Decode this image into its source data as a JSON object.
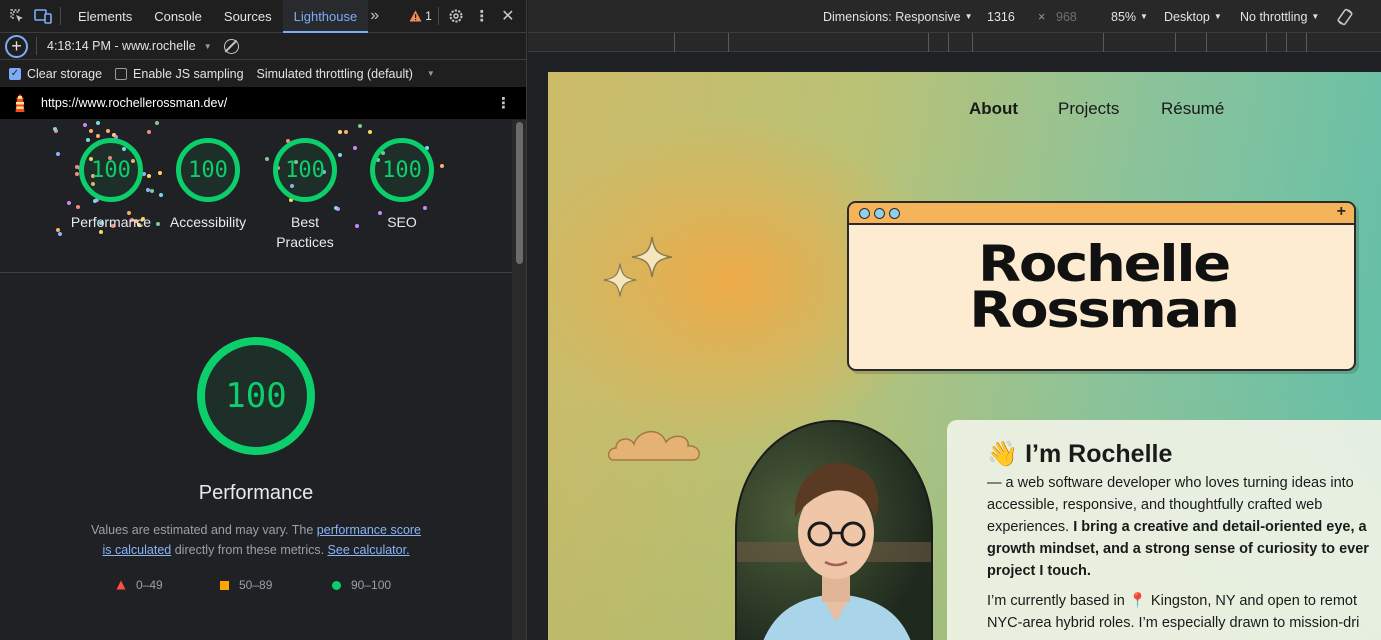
{
  "devtools": {
    "tabs": [
      "Elements",
      "Console",
      "Sources",
      "Lighthouse"
    ],
    "active_tab": "Lighthouse",
    "more_tabs_icon": "chevron-double-right-icon",
    "warning_count": "1",
    "toolbar_icons": [
      "inspect-element-icon",
      "device-toolbar-icon",
      "settings-icon",
      "more-vertical-icon",
      "close-icon"
    ],
    "report_selector": "4:18:14 PM - www.rochelle",
    "options": {
      "clear_storage": "Clear storage",
      "clear_storage_checked": true,
      "js_sampling": "Enable JS sampling",
      "js_sampling_checked": false,
      "throttling": "Simulated throttling (default)"
    },
    "url": "https://www.rochellerossman.dev/",
    "scores": [
      {
        "label": "Performance",
        "score": "100"
      },
      {
        "label": "Accessibility",
        "score": "100"
      },
      {
        "label": "Best Practices",
        "score": "100"
      },
      {
        "label": "SEO",
        "score": "100"
      }
    ],
    "performance": {
      "score": "100",
      "title": "Performance",
      "desc_1": "Values are estimated and may vary. The ",
      "desc_link_1": "performance score is calculated",
      "desc_2": " directly from these metrics. ",
      "desc_link_2": "See calculator."
    },
    "legend": [
      {
        "range": "0–49",
        "color": "#ff4e42",
        "shape": "triangle"
      },
      {
        "range": "50–89",
        "color": "#ffa400",
        "shape": "square"
      },
      {
        "range": "90–100",
        "color": "#0cce6b",
        "shape": "circle"
      }
    ]
  },
  "device_toolbar": {
    "dimensions_label": "Dimensions: Responsive",
    "width": "1316",
    "times": "×",
    "height": "968",
    "zoom": "85%",
    "device_type": "Desktop",
    "throttling": "No throttling",
    "rotate_icon": "rotate-icon"
  },
  "site": {
    "nav": [
      "About",
      "Projects",
      "Résumé"
    ],
    "name_line1": "Rochelle",
    "name_line2": "Rossman",
    "window_plus": "+",
    "about_emoji": "👋",
    "about_title": "I’m Rochelle",
    "about_line1": "— a web software developer who loves turning ideas into",
    "about_line2": "accessible, responsive, and thoughtfully crafted web",
    "about_line3_plain": "experiences. ",
    "about_line3_bold": "I bring a creative and detail-oriented eye, a",
    "about_line4_bold": "growth mindset, and a strong sense of curiosity to ever",
    "about_line5_bold": "project I touch.",
    "about_p2_line1_a": "I’m currently based in ",
    "about_p2_pin": "📍",
    "about_p2_line1_b": " Kingston, NY and open to remot",
    "about_p2_line2": "NYC-area hybrid roles. I’m especially drawn to mission-dri"
  }
}
